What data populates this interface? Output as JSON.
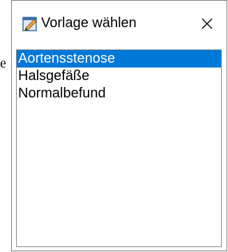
{
  "backdrop": {
    "fragment": "e"
  },
  "window": {
    "title": "Vorlage wählen",
    "icon": "notepad-pencil-icon",
    "close_icon": "close-icon"
  },
  "list": {
    "selected_index": 0,
    "selection_color": "#0078d7",
    "items": [
      {
        "label": "Aortensstenose"
      },
      {
        "label": "Halsgefäße"
      },
      {
        "label": "Normalbefund"
      }
    ]
  }
}
